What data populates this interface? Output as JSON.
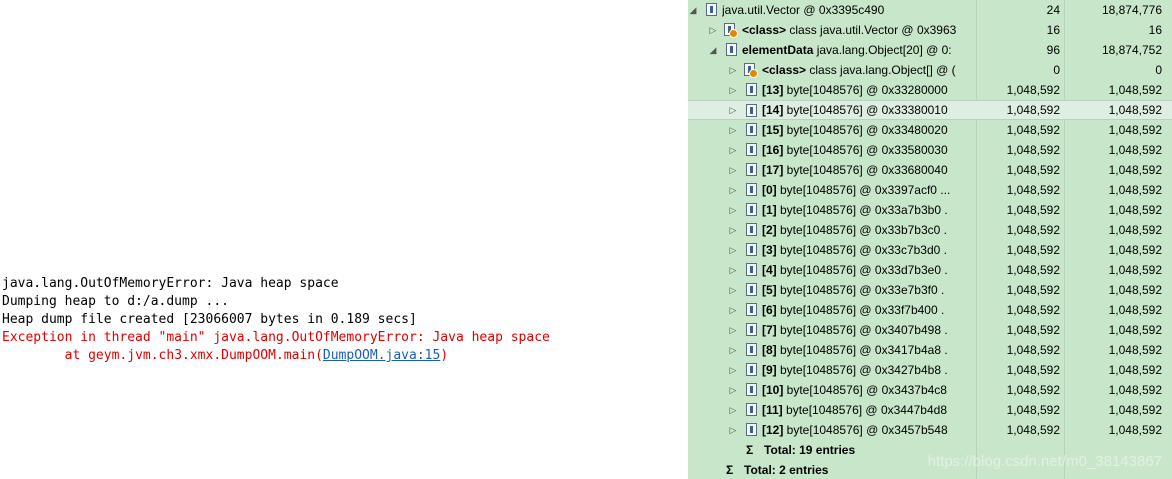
{
  "console": {
    "lines": [
      {
        "text": "java.lang.OutOfMemoryError: Java heap space"
      },
      {
        "text": "Dumping heap to d:/a.dump ..."
      },
      {
        "text": "Heap dump file created [23066007 bytes in 0.189 secs]"
      },
      {
        "text": "Exception in thread \"main\" java.lang.OutOfMemoryError: Java heap space"
      },
      {
        "prefix": "\tat geym.jvm.ch3.xmx.DumpOOM.main(",
        "link": "DumpOOM.java:15",
        "suffix": ")"
      }
    ]
  },
  "tree": {
    "root": {
      "arrow": "◢",
      "name": "java.util.Vector @ 0x3395c490",
      "shallow": "24",
      "retained": "18,874,776"
    },
    "class_row": {
      "arrow": "▷",
      "tag": "<class>",
      "rest": " class java.util.Vector @ 0x3963",
      "shallow": "16",
      "retained": "16"
    },
    "elementData": {
      "arrow": "◢",
      "tag": "elementData",
      "rest": " java.lang.Object[20] @ 0:",
      "shallow": "96",
      "retained": "18,874,752"
    },
    "obj_class_row": {
      "arrow": "▷",
      "tag": "<class>",
      "rest": " class java.lang.Object[] @ (",
      "shallow": "0",
      "retained": "0"
    },
    "items": [
      {
        "idx": "[13]",
        "rest": " byte[1048576] @ 0x33280000",
        "shallow": "1,048,592",
        "retained": "1,048,592"
      },
      {
        "idx": "[14]",
        "rest": " byte[1048576] @ 0x33380010",
        "shallow": "1,048,592",
        "retained": "1,048,592"
      },
      {
        "idx": "[15]",
        "rest": " byte[1048576] @ 0x33480020",
        "shallow": "1,048,592",
        "retained": "1,048,592"
      },
      {
        "idx": "[16]",
        "rest": " byte[1048576] @ 0x33580030",
        "shallow": "1,048,592",
        "retained": "1,048,592"
      },
      {
        "idx": "[17]",
        "rest": " byte[1048576] @ 0x33680040",
        "shallow": "1,048,592",
        "retained": "1,048,592"
      },
      {
        "idx": "[0]",
        "rest": " byte[1048576] @ 0x3397acf0  ...",
        "shallow": "1,048,592",
        "retained": "1,048,592"
      },
      {
        "idx": "[1]",
        "rest": " byte[1048576] @ 0x33a7b3b0  .",
        "shallow": "1,048,592",
        "retained": "1,048,592"
      },
      {
        "idx": "[2]",
        "rest": " byte[1048576] @ 0x33b7b3c0  .",
        "shallow": "1,048,592",
        "retained": "1,048,592"
      },
      {
        "idx": "[3]",
        "rest": " byte[1048576] @ 0x33c7b3d0  .",
        "shallow": "1,048,592",
        "retained": "1,048,592"
      },
      {
        "idx": "[4]",
        "rest": " byte[1048576] @ 0x33d7b3e0  .",
        "shallow": "1,048,592",
        "retained": "1,048,592"
      },
      {
        "idx": "[5]",
        "rest": " byte[1048576] @ 0x33e7b3f0  .",
        "shallow": "1,048,592",
        "retained": "1,048,592"
      },
      {
        "idx": "[6]",
        "rest": " byte[1048576] @ 0x33f7b400  .",
        "shallow": "1,048,592",
        "retained": "1,048,592"
      },
      {
        "idx": "[7]",
        "rest": " byte[1048576] @ 0x3407b498  .",
        "shallow": "1,048,592",
        "retained": "1,048,592"
      },
      {
        "idx": "[8]",
        "rest": " byte[1048576] @ 0x3417b4a8  .",
        "shallow": "1,048,592",
        "retained": "1,048,592"
      },
      {
        "idx": "[9]",
        "rest": " byte[1048576] @ 0x3427b4b8  .",
        "shallow": "1,048,592",
        "retained": "1,048,592"
      },
      {
        "idx": "[10]",
        "rest": " byte[1048576] @ 0x3437b4c8",
        "shallow": "1,048,592",
        "retained": "1,048,592"
      },
      {
        "idx": "[11]",
        "rest": " byte[1048576] @ 0x3447b4d8",
        "shallow": "1,048,592",
        "retained": "1,048,592"
      },
      {
        "idx": "[12]",
        "rest": " byte[1048576] @ 0x3457b548",
        "shallow": "1,048,592",
        "retained": "1,048,592"
      }
    ],
    "total_inner": {
      "sigma": "Σ",
      "label": "Total: 19 entries"
    },
    "total_outer": {
      "sigma": "Σ",
      "label": "Total: 2 entries"
    }
  },
  "watermark": "https://blog.csdn.net/m0_38143867"
}
